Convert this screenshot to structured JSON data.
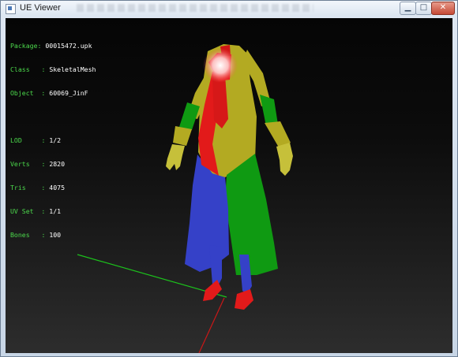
{
  "window": {
    "title": "UE Viewer",
    "buttons": {
      "minimize": "▁",
      "maximize": "□",
      "close": "✕"
    }
  },
  "info": {
    "package": {
      "key": "Package",
      "value": "00015472.upk"
    },
    "class": {
      "key": "Class",
      "value": "SkeletalMesh"
    },
    "object": {
      "key": "Object",
      "value": "60069_JinF"
    },
    "lod": {
      "key": "LOD",
      "value": "1/2"
    },
    "verts": {
      "key": "Verts",
      "value": "2820"
    },
    "tris": {
      "key": "Tris",
      "value": "4075"
    },
    "uvset": {
      "key": "UV Set",
      "value": "1/1"
    },
    "bones": {
      "key": "Bones",
      "value": "100"
    }
  },
  "colors": {
    "coat_yellow": "#b3aa22",
    "coat_green": "#0f9a12",
    "coat_blue": "#3541c8",
    "accent_red": "#e21a1a",
    "hand_yellow": "#c6c03a",
    "axis_green": "#1cc21c",
    "axis_red": "#c81818",
    "info_label": "#4cd94c",
    "info_value": "#ffffff"
  }
}
